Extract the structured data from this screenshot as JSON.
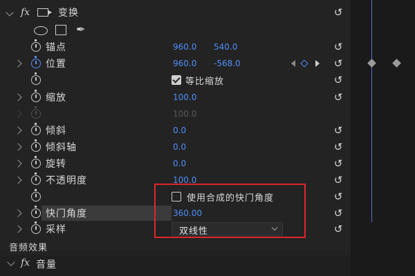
{
  "transform": {
    "title": "变换",
    "fx": "fx",
    "properties": {
      "anchor": {
        "label": "锚点",
        "x": "960.0",
        "y": "540.0"
      },
      "position": {
        "label": "位置",
        "x": "960.0",
        "y": "-568.0"
      },
      "uniform_scale": {
        "label": "等比缩放",
        "checked": true
      },
      "scale": {
        "label": "缩放",
        "value": "100.0"
      },
      "scale_width": {
        "value": "100.0"
      },
      "skew": {
        "label": "倾斜",
        "value": "0.0"
      },
      "skew_axis": {
        "label": "倾斜轴",
        "value": "0.0"
      },
      "rotation": {
        "label": "旋转",
        "value": "0.0"
      },
      "opacity": {
        "label": "不透明度",
        "value": "100.0"
      },
      "use_comp_shutter": {
        "label": "使用合成的快门角度",
        "checked": false
      },
      "shutter_angle": {
        "label": "快门角度",
        "value": "360.00"
      },
      "sampling": {
        "label": "采样",
        "selected": "双线性"
      }
    }
  },
  "audio_effects": {
    "title": "音频效果"
  },
  "volume": {
    "title": "音量",
    "fx": "fx"
  },
  "icons": {
    "reset": "reset-icon",
    "stopwatch": "stopwatch-icon",
    "ellipse": "ellipse-mask-icon",
    "rect": "rectangle-mask-icon",
    "pen": "pen-mask-icon"
  },
  "colors": {
    "value_blue": "#4f8ef7",
    "highlight_red": "#e0262b",
    "playhead": "#4f6fd8"
  }
}
